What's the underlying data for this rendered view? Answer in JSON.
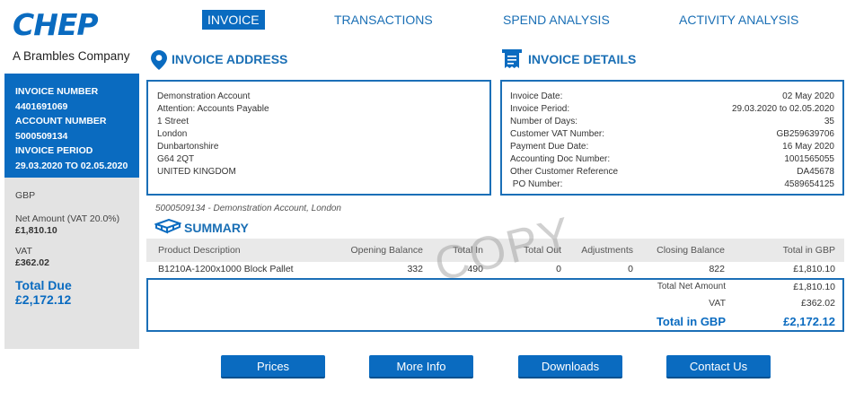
{
  "brand": {
    "name": "CHEP",
    "tagline": "A Brambles Company"
  },
  "nav": [
    {
      "label": "INVOICE",
      "active": true
    },
    {
      "label": "TRANSACTIONS"
    },
    {
      "label": "SPEND ANALYSIS"
    },
    {
      "label": "ACTIVITY ANALYSIS"
    }
  ],
  "sidebar": {
    "invoice_number_label": "INVOICE NUMBER",
    "invoice_number": "4401691069",
    "account_number_label": "ACCOUNT NUMBER",
    "account_number": "5000509134",
    "invoice_period_label": "INVOICE PERIOD",
    "invoice_period": "29.03.2020 TO 02.05.2020",
    "currency": "GBP",
    "net_amount_label": "Net Amount (VAT 20.0%)",
    "net_amount": "£1,810.10",
    "vat_label": "VAT",
    "vat": "£362.02",
    "total_due_label": "Total Due",
    "total_due": "£2,172.12"
  },
  "invoice_address": {
    "title": "INVOICE ADDRESS",
    "lines": [
      "Demonstration Account",
      "Attention:  Accounts Payable",
      "1 Street",
      "London",
      "Dunbartonshire",
      "G64 2QT",
      "UNITED KINGDOM"
    ]
  },
  "invoice_details": {
    "title": "INVOICE DETAILS",
    "rows": [
      {
        "label": "Invoice Date:",
        "value": "02 May 2020"
      },
      {
        "label": "Invoice Period:",
        "value": "29.03.2020 to 02.05.2020"
      },
      {
        "label": "Number of Days:",
        "value": "35"
      },
      {
        "label": "Customer VAT Number:",
        "value": "GB259639706"
      },
      {
        "label": "Payment Due Date:",
        "value": "16 May 2020"
      },
      {
        "label": "Accounting Doc Number:",
        "value": "1001565055"
      },
      {
        "label": "Other Customer Reference",
        "value": "DA45678"
      },
      {
        "label": " PO Number:",
        "value": "4589654125"
      }
    ]
  },
  "account_caption": "5000509134 - Demonstration Account, London",
  "summary": {
    "title": "SUMMARY",
    "headers": [
      "Product Description",
      "Opening Balance",
      "Total In",
      "Total Out",
      "Adjustments",
      "Closing Balance",
      "Total in GBP"
    ],
    "row": [
      "B1210A-1200x1000 Block Pallet",
      "332",
      "490",
      "0",
      "0",
      "822",
      "£1,810.10"
    ],
    "total_net_label": "Total Net Amount",
    "total_net": "£1,810.10",
    "vat_label": "VAT",
    "vat": "£362.02",
    "total_label": "Total in GBP",
    "total": "£2,172.12"
  },
  "watermark": "COPY",
  "buttons": [
    "Prices",
    "More Info",
    "Downloads",
    "Contact Us"
  ],
  "colors": {
    "brand_blue": "#0a6bc0",
    "sidebar_grey": "#e3e3e3"
  }
}
